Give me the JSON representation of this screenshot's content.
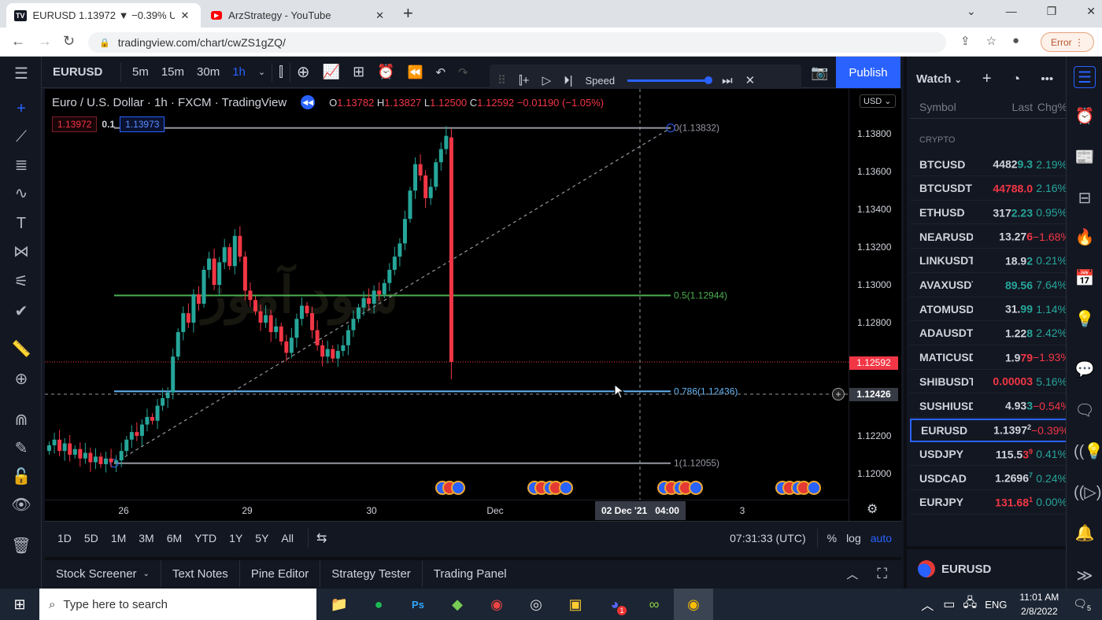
{
  "browser": {
    "tabs": [
      {
        "title": "EURUSD 1.13972 ▼ −0.39% Unn",
        "icon": "tradingview-icon",
        "active": true
      },
      {
        "title": "ArzStrategy - YouTube",
        "icon": "youtube-icon",
        "active": false
      }
    ],
    "url": "tradingview.com/chart/cwZS1gZQ/",
    "error_label": "Error"
  },
  "toolbar": {
    "symbol": "EURUSD",
    "intervals": [
      "5m",
      "15m",
      "30m",
      "1h"
    ],
    "active_interval": "1h",
    "publish_label": "Publish",
    "replay": {
      "speed_label": "Speed",
      "speed_level": 1.0
    }
  },
  "legend": {
    "title": "Euro / U.S. Dollar · 1h · FXCM · TradingView",
    "o_label": "O",
    "o": "1.13782",
    "h_label": "H",
    "h": "1.13827",
    "l_label": "L",
    "l": "1.12500",
    "c_label": "C",
    "c": "1.12592",
    "change": "−0.01190 (−1.05%)",
    "sell": "1.13972",
    "qty": "0.1",
    "buy": "1.13973",
    "currency": "USD"
  },
  "watermark": "سود آموز",
  "fib": [
    {
      "label": "0(1.13832)",
      "price": 1.13832,
      "color": "#9598a1"
    },
    {
      "label": "0.5(1.12944)",
      "price": 1.12944,
      "color": "#4caf50"
    },
    {
      "label": "0.786(1.12436)",
      "price": 1.12436,
      "color": "#64b5f6"
    },
    {
      "label": "1(1.12055)",
      "price": 1.12055,
      "color": "#9598a1"
    }
  ],
  "price_axis": {
    "labels": [
      "1.13800",
      "1.13600",
      "1.13400",
      "1.13200",
      "1.13000",
      "1.12800",
      "1.12200",
      "1.12000"
    ],
    "current_price": "1.12592",
    "crosshair_price": "1.12426"
  },
  "time_axis": {
    "labels": [
      "26",
      "29",
      "30",
      "Dec",
      "3"
    ],
    "crosshair": "02 Dec '21   04:00"
  },
  "chart_data": {
    "type": "candlestick",
    "interval": "1h",
    "ylim": [
      1.11862,
      1.14039
    ],
    "closes": [
      1.1215,
      1.1218,
      1.1212,
      1.1216,
      1.121,
      1.1213,
      1.1208,
      1.1211,
      1.1206,
      1.1209,
      1.1205,
      1.1208,
      1.1206,
      1.1207,
      1.1212,
      1.1218,
      1.1222,
      1.122,
      1.1226,
      1.123,
      1.1228,
      1.1236,
      1.124,
      1.1243,
      1.1262,
      1.1275,
      1.1285,
      1.128,
      1.1295,
      1.129,
      1.1308,
      1.1314,
      1.13,
      1.1312,
      1.132,
      1.131,
      1.1326,
      1.1315,
      1.1297,
      1.1292,
      1.1286,
      1.128,
      1.1284,
      1.1275,
      1.1278,
      1.127,
      1.1264,
      1.1272,
      1.1282,
      1.1289,
      1.1285,
      1.1276,
      1.1268,
      1.1262,
      1.1266,
      1.1261,
      1.1265,
      1.1268,
      1.1276,
      1.1282,
      1.1288,
      1.1293,
      1.129,
      1.1297,
      1.1295,
      1.1301,
      1.1308,
      1.1315,
      1.1322,
      1.1335,
      1.135,
      1.1364,
      1.1358,
      1.1346,
      1.1352,
      1.1365,
      1.1372,
      1.1379,
      1.1259
    ],
    "last_candle": {
      "open": 1.13782,
      "high": 1.13827,
      "low": 1.125,
      "close": 1.12592
    },
    "up_color": "#26a69a",
    "down_color": "#f23645"
  },
  "range_bar": {
    "ranges": [
      "1D",
      "5D",
      "1M",
      "3M",
      "6M",
      "YTD",
      "1Y",
      "5Y",
      "All"
    ],
    "clock": "07:31:33 (UTC)",
    "percent": "%",
    "log": "log",
    "auto": "auto"
  },
  "bottom_tabs": [
    "Stock Screener",
    "Text Notes",
    "Pine Editor",
    "Strategy Tester",
    "Trading Panel"
  ],
  "watchlist": {
    "title": "Watch",
    "columns": [
      "Symbol",
      "Last",
      "Chg%"
    ],
    "section": "CRYPTO",
    "rows": [
      {
        "sym": "BTCUSD",
        "a": "4482",
        "b": "9.3",
        "bc": "g",
        "sup": "",
        "chg": "2.19%",
        "cc": "g"
      },
      {
        "sym": "BTCUSDT",
        "a": "",
        "b": "44788.0",
        "bc": "r",
        "sup": "",
        "chg": "2.16%",
        "cc": "g"
      },
      {
        "sym": "ETHUSD",
        "a": "317",
        "b": "2.23",
        "bc": "g",
        "sup": "",
        "chg": "0.95%",
        "cc": "g"
      },
      {
        "sym": "NEARUSD",
        "a": "13.27",
        "b": "6",
        "bc": "r",
        "sup": "",
        "chg": "−1.68%",
        "cc": "r"
      },
      {
        "sym": "LINKUSDT",
        "a": "18.9",
        "b": "2",
        "bc": "g",
        "sup": "",
        "chg": "0.21%",
        "cc": "g"
      },
      {
        "sym": "AVAXUSDT",
        "a": "",
        "b": "89.56",
        "bc": "g",
        "sup": "",
        "chg": "7.64%",
        "cc": "g"
      },
      {
        "sym": "ATOMUSD",
        "a": "31.",
        "b": "99",
        "bc": "g",
        "sup": "",
        "chg": "1.14%",
        "cc": "g"
      },
      {
        "sym": "ADAUSDT",
        "a": "1.22",
        "b": "8",
        "bc": "g",
        "sup": "",
        "chg": "2.42%",
        "cc": "g"
      },
      {
        "sym": "MATICUSD",
        "a": "1.9",
        "b": "79",
        "bc": "r",
        "sup": "",
        "chg": "−1.93%",
        "cc": "r"
      },
      {
        "sym": "SHIBUSDT",
        "a": "",
        "b": "0.00003",
        "bc": "r",
        "sup": "",
        "chg": "5.16%",
        "cc": "g"
      },
      {
        "sym": "SUSHIUSD",
        "a": "4.93",
        "b": "3",
        "bc": "g",
        "sup": "",
        "chg": "−0.54%",
        "cc": "r"
      },
      {
        "sym": "EURUSD",
        "a": "1.1397",
        "b": "",
        "bc": "w",
        "sup": "2",
        "chg": "−0.39%",
        "cc": "r",
        "selected": true
      },
      {
        "sym": "USDJPY",
        "a": "115.5",
        "b": "3",
        "bc": "r",
        "sup": "9",
        "chg": "0.41%",
        "cc": "g"
      },
      {
        "sym": "USDCAD",
        "a": "1.2696",
        "b": "",
        "bc": "g",
        "sup": "7",
        "chg": "0.24%",
        "cc": "g"
      },
      {
        "sym": "EURJPY",
        "a": "",
        "b": "131.68",
        "bc": "r",
        "sup": "1",
        "chg": "0.00%",
        "cc": "g"
      }
    ],
    "details_symbol": "EURUSD"
  },
  "taskbar": {
    "search_placeholder": "Type here to search",
    "lang": "ENG",
    "time": "11:01 AM",
    "date": "2/8/2022",
    "notifications": "5",
    "discord_badge": "1"
  }
}
